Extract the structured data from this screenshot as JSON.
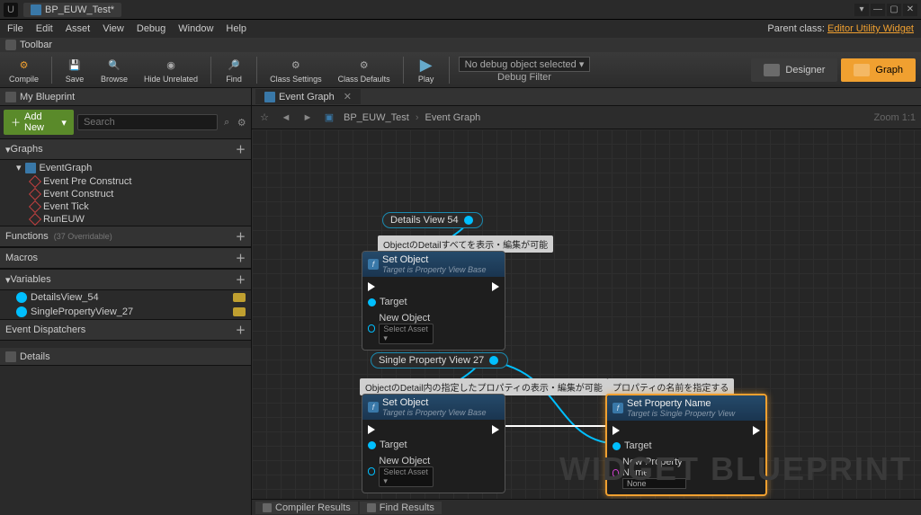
{
  "title_tab": "BP_EUW_Test*",
  "menus": [
    "File",
    "Edit",
    "Asset",
    "View",
    "Debug",
    "Window",
    "Help"
  ],
  "parent_class_label": "Parent class:",
  "parent_class_value": "Editor Utility Widget",
  "toolbar_label": "Toolbar",
  "tools": {
    "compile": "Compile",
    "save": "Save",
    "browse": "Browse",
    "hide": "Hide Unrelated",
    "find": "Find",
    "classsettings": "Class Settings",
    "classdefaults": "Class Defaults",
    "play": "Play"
  },
  "debug": {
    "selected": "No debug object selected ▾",
    "filter": "Debug Filter"
  },
  "modes": {
    "designer": "Designer",
    "graph": "Graph"
  },
  "my_blueprint_tab": "My Blueprint",
  "add_new": "Add New",
  "search_placeholder": "Search",
  "sections": {
    "graphs": "Graphs",
    "functions": "Functions",
    "functions_note": "(37 Overridable)",
    "macros": "Macros",
    "variables": "Variables",
    "event_dispatchers": "Event Dispatchers"
  },
  "graph_tree": {
    "root": "EventGraph",
    "items": [
      "Event Pre Construct",
      "Event Construct",
      "Event Tick",
      "RunEUW"
    ]
  },
  "variables": [
    "DetailsView_54",
    "SinglePropertyView_27"
  ],
  "details_tab": "Details",
  "graph_tab": "Event Graph",
  "crumb_root": "BP_EUW_Test",
  "crumb_leaf": "Event Graph",
  "zoom": "Zoom 1:1",
  "watermark": "WIDGET BLUEPRINT",
  "nodes": {
    "var1": "Details View 54",
    "var2": "Single Property View 27",
    "comment1": "ObjectのDetailすべてを表示・編集が可能",
    "comment2": "ObjectのDetail内の指定したプロパティの表示・編集が可能",
    "comment3": "プロパティの名前を指定する",
    "setobj_title": "Set Object",
    "setobj_sub": "Target is Property View Base",
    "target": "Target",
    "new_object": "New Object",
    "select_asset": "Select Asset ▾",
    "setprop_title": "Set Property Name",
    "setprop_sub": "Target is Single Property View",
    "new_prop_name": "New Property Name",
    "none": "None"
  },
  "bottom": {
    "compiler": "Compiler Results",
    "find": "Find Results"
  }
}
